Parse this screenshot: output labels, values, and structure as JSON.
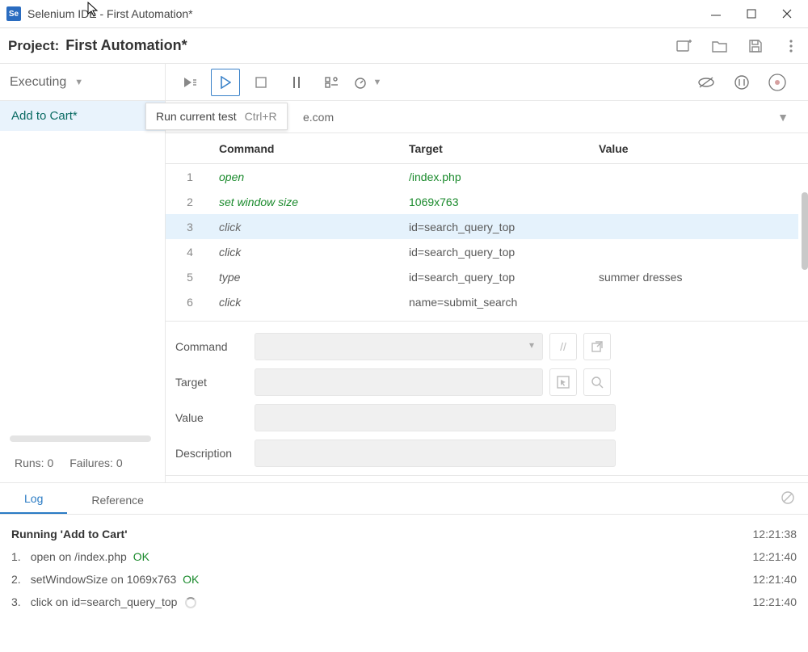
{
  "window": {
    "app": "Se",
    "title": "Selenium IDE - First Automation*"
  },
  "project": {
    "label": "Project:",
    "name": "First Automation*"
  },
  "status": {
    "executing": "Executing"
  },
  "tests": {
    "items": [
      "Add to Cart*"
    ],
    "runs_label": "Runs: 0",
    "failures_label": "Failures: 0"
  },
  "tooltip": {
    "label": "Run current test",
    "shortcut": "Ctrl+R"
  },
  "url": {
    "visible_fragment": "e.com"
  },
  "table": {
    "headers": {
      "command": "Command",
      "target": "Target",
      "value": "Value"
    },
    "rows": [
      {
        "idx": "1",
        "cmd": "open",
        "tgt": "/index.php",
        "val": "",
        "ok": true
      },
      {
        "idx": "2",
        "cmd": "set window size",
        "tgt": "1069x763",
        "val": "",
        "ok": true
      },
      {
        "idx": "3",
        "cmd": "click",
        "tgt": "id=search_query_top",
        "val": "",
        "sel": true
      },
      {
        "idx": "4",
        "cmd": "click",
        "tgt": "id=search_query_top",
        "val": ""
      },
      {
        "idx": "5",
        "cmd": "type",
        "tgt": "id=search_query_top",
        "val": "summer dresses"
      },
      {
        "idx": "6",
        "cmd": "click",
        "tgt": "name=submit_search",
        "val": ""
      }
    ]
  },
  "editor": {
    "labels": {
      "command": "Command",
      "target": "Target",
      "value": "Value",
      "description": "Description"
    }
  },
  "logtabs": {
    "log": "Log",
    "reference": "Reference"
  },
  "log": {
    "running": "Running 'Add to Cart'",
    "ts1": "12:21:38",
    "lines": [
      {
        "n": "1.",
        "text": "open on /index.php",
        "ok": "OK",
        "ts": "12:21:40"
      },
      {
        "n": "2.",
        "text": "setWindowSize on 1069x763",
        "ok": "OK",
        "ts": "12:21:40"
      },
      {
        "n": "3.",
        "text": "click on id=search_query_top",
        "spin": true,
        "ts": "12:21:40"
      }
    ]
  }
}
